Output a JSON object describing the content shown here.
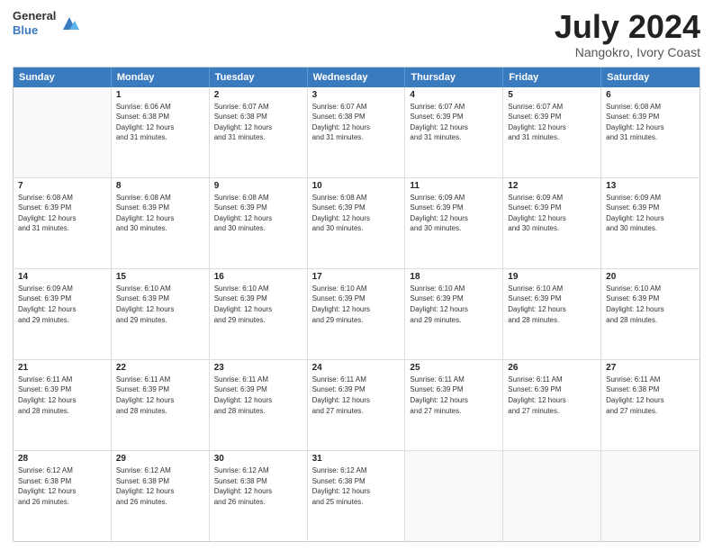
{
  "logo": {
    "line1": "General",
    "line2": "Blue"
  },
  "title": {
    "month_year": "July 2024",
    "location": "Nangokro, Ivory Coast"
  },
  "calendar": {
    "headers": [
      "Sunday",
      "Monday",
      "Tuesday",
      "Wednesday",
      "Thursday",
      "Friday",
      "Saturday"
    ],
    "weeks": [
      [
        {
          "day": "",
          "lines": []
        },
        {
          "day": "1",
          "lines": [
            "Sunrise: 6:06 AM",
            "Sunset: 6:38 PM",
            "Daylight: 12 hours",
            "and 31 minutes."
          ]
        },
        {
          "day": "2",
          "lines": [
            "Sunrise: 6:07 AM",
            "Sunset: 6:38 PM",
            "Daylight: 12 hours",
            "and 31 minutes."
          ]
        },
        {
          "day": "3",
          "lines": [
            "Sunrise: 6:07 AM",
            "Sunset: 6:38 PM",
            "Daylight: 12 hours",
            "and 31 minutes."
          ]
        },
        {
          "day": "4",
          "lines": [
            "Sunrise: 6:07 AM",
            "Sunset: 6:39 PM",
            "Daylight: 12 hours",
            "and 31 minutes."
          ]
        },
        {
          "day": "5",
          "lines": [
            "Sunrise: 6:07 AM",
            "Sunset: 6:39 PM",
            "Daylight: 12 hours",
            "and 31 minutes."
          ]
        },
        {
          "day": "6",
          "lines": [
            "Sunrise: 6:08 AM",
            "Sunset: 6:39 PM",
            "Daylight: 12 hours",
            "and 31 minutes."
          ]
        }
      ],
      [
        {
          "day": "7",
          "lines": [
            "Sunrise: 6:08 AM",
            "Sunset: 6:39 PM",
            "Daylight: 12 hours",
            "and 31 minutes."
          ]
        },
        {
          "day": "8",
          "lines": [
            "Sunrise: 6:08 AM",
            "Sunset: 6:39 PM",
            "Daylight: 12 hours",
            "and 30 minutes."
          ]
        },
        {
          "day": "9",
          "lines": [
            "Sunrise: 6:08 AM",
            "Sunset: 6:39 PM",
            "Daylight: 12 hours",
            "and 30 minutes."
          ]
        },
        {
          "day": "10",
          "lines": [
            "Sunrise: 6:08 AM",
            "Sunset: 6:39 PM",
            "Daylight: 12 hours",
            "and 30 minutes."
          ]
        },
        {
          "day": "11",
          "lines": [
            "Sunrise: 6:09 AM",
            "Sunset: 6:39 PM",
            "Daylight: 12 hours",
            "and 30 minutes."
          ]
        },
        {
          "day": "12",
          "lines": [
            "Sunrise: 6:09 AM",
            "Sunset: 6:39 PM",
            "Daylight: 12 hours",
            "and 30 minutes."
          ]
        },
        {
          "day": "13",
          "lines": [
            "Sunrise: 6:09 AM",
            "Sunset: 6:39 PM",
            "Daylight: 12 hours",
            "and 30 minutes."
          ]
        }
      ],
      [
        {
          "day": "14",
          "lines": [
            "Sunrise: 6:09 AM",
            "Sunset: 6:39 PM",
            "Daylight: 12 hours",
            "and 29 minutes."
          ]
        },
        {
          "day": "15",
          "lines": [
            "Sunrise: 6:10 AM",
            "Sunset: 6:39 PM",
            "Daylight: 12 hours",
            "and 29 minutes."
          ]
        },
        {
          "day": "16",
          "lines": [
            "Sunrise: 6:10 AM",
            "Sunset: 6:39 PM",
            "Daylight: 12 hours",
            "and 29 minutes."
          ]
        },
        {
          "day": "17",
          "lines": [
            "Sunrise: 6:10 AM",
            "Sunset: 6:39 PM",
            "Daylight: 12 hours",
            "and 29 minutes."
          ]
        },
        {
          "day": "18",
          "lines": [
            "Sunrise: 6:10 AM",
            "Sunset: 6:39 PM",
            "Daylight: 12 hours",
            "and 29 minutes."
          ]
        },
        {
          "day": "19",
          "lines": [
            "Sunrise: 6:10 AM",
            "Sunset: 6:39 PM",
            "Daylight: 12 hours",
            "and 28 minutes."
          ]
        },
        {
          "day": "20",
          "lines": [
            "Sunrise: 6:10 AM",
            "Sunset: 6:39 PM",
            "Daylight: 12 hours",
            "and 28 minutes."
          ]
        }
      ],
      [
        {
          "day": "21",
          "lines": [
            "Sunrise: 6:11 AM",
            "Sunset: 6:39 PM",
            "Daylight: 12 hours",
            "and 28 minutes."
          ]
        },
        {
          "day": "22",
          "lines": [
            "Sunrise: 6:11 AM",
            "Sunset: 6:39 PM",
            "Daylight: 12 hours",
            "and 28 minutes."
          ]
        },
        {
          "day": "23",
          "lines": [
            "Sunrise: 6:11 AM",
            "Sunset: 6:39 PM",
            "Daylight: 12 hours",
            "and 28 minutes."
          ]
        },
        {
          "day": "24",
          "lines": [
            "Sunrise: 6:11 AM",
            "Sunset: 6:39 PM",
            "Daylight: 12 hours",
            "and 27 minutes."
          ]
        },
        {
          "day": "25",
          "lines": [
            "Sunrise: 6:11 AM",
            "Sunset: 6:39 PM",
            "Daylight: 12 hours",
            "and 27 minutes."
          ]
        },
        {
          "day": "26",
          "lines": [
            "Sunrise: 6:11 AM",
            "Sunset: 6:39 PM",
            "Daylight: 12 hours",
            "and 27 minutes."
          ]
        },
        {
          "day": "27",
          "lines": [
            "Sunrise: 6:11 AM",
            "Sunset: 6:38 PM",
            "Daylight: 12 hours",
            "and 27 minutes."
          ]
        }
      ],
      [
        {
          "day": "28",
          "lines": [
            "Sunrise: 6:12 AM",
            "Sunset: 6:38 PM",
            "Daylight: 12 hours",
            "and 26 minutes."
          ]
        },
        {
          "day": "29",
          "lines": [
            "Sunrise: 6:12 AM",
            "Sunset: 6:38 PM",
            "Daylight: 12 hours",
            "and 26 minutes."
          ]
        },
        {
          "day": "30",
          "lines": [
            "Sunrise: 6:12 AM",
            "Sunset: 6:38 PM",
            "Daylight: 12 hours",
            "and 26 minutes."
          ]
        },
        {
          "day": "31",
          "lines": [
            "Sunrise: 6:12 AM",
            "Sunset: 6:38 PM",
            "Daylight: 12 hours",
            "and 25 minutes."
          ]
        },
        {
          "day": "",
          "lines": []
        },
        {
          "day": "",
          "lines": []
        },
        {
          "day": "",
          "lines": []
        }
      ]
    ]
  }
}
